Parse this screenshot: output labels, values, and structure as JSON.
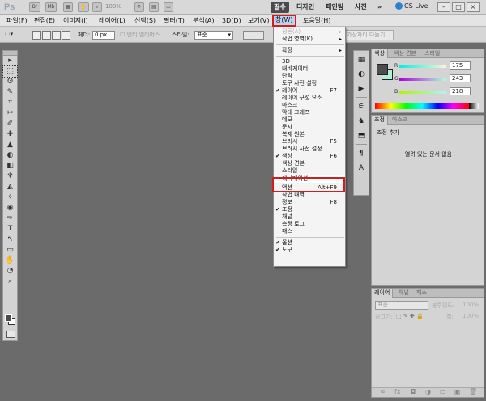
{
  "appbar": {
    "logo": "Ps",
    "icon_br": "Br",
    "icon_mb": "Mb",
    "zoom": "100%",
    "workspaces": [
      "필수",
      "디자인",
      "페인팅",
      "사진"
    ],
    "more": "»",
    "cs_live": "CS Live",
    "win_minimize": "–",
    "win_restore": "□",
    "win_close": "×"
  },
  "menubar": {
    "items": [
      "파일(F)",
      "편집(E)",
      "이미지(I)",
      "레이어(L)",
      "선택(S)",
      "필터(T)",
      "분석(A)",
      "3D(D)",
      "보기(V)",
      "창(W)",
      "도움말(H)"
    ]
  },
  "options": {
    "feather_label": "페더:",
    "feather_value": "0 px",
    "antialias": "앤티 앨리어스",
    "style_label": "스타일:",
    "style_value": "표준",
    "refine_edge": "가장자리 다듬기..."
  },
  "tools": [
    "▸",
    "⬚",
    "ʘ",
    "✎",
    "⌗",
    "✂",
    "✐",
    "✚",
    "▲",
    "◐",
    "◧",
    "♆",
    "◭",
    "✧",
    "◉",
    "✑",
    "T",
    "↖",
    "▭",
    "✋",
    "◔",
    "⌕"
  ],
  "iconstrip": [
    "▦",
    "◐",
    "▶",
    "⚟",
    "♞",
    "⬒",
    "¶",
    "A"
  ],
  "color_panel": {
    "tabs": [
      "색상",
      "색상 견본",
      "스타일"
    ],
    "r_label": "R",
    "g_label": "G",
    "b_label": "B",
    "r_value": "175",
    "g_value": "243",
    "b_value": "218",
    "fg_color": "#4d4d4d",
    "bg_color": "#afefda"
  },
  "adjust_panel": {
    "tabs": [
      "조정",
      "마스크"
    ],
    "title": "조정 추가",
    "empty": "열려 있는 문서 없음"
  },
  "layers_panel": {
    "tabs": [
      "레이어",
      "채널",
      "패스"
    ],
    "blend": "표준",
    "opacity_label": "불투명도:",
    "opacity_value": "100%",
    "lock_label": "잠그기:",
    "fill_label": "칠:",
    "fill_value": "100%",
    "footer_icons": [
      "∞",
      "fx",
      "◘",
      "◑",
      "▭",
      "▣",
      "🗑"
    ]
  },
  "window_menu": {
    "items": [
      {
        "label": "정돈(A)",
        "arrow": "▸"
      },
      {
        "label": "작업 영역(K)",
        "arrow": "▸"
      },
      {
        "label": "확장",
        "arrow": "▸"
      },
      {
        "label": "3D"
      },
      {
        "label": "내비게이터"
      },
      {
        "label": "단락"
      },
      {
        "label": "도구 사전 설정"
      },
      {
        "label": "레이어",
        "shortcut": "F7",
        "checked": true
      },
      {
        "label": "레이어 구성 요소"
      },
      {
        "label": "마스크"
      },
      {
        "label": "막대 그래프"
      },
      {
        "label": "메모"
      },
      {
        "label": "문자"
      },
      {
        "label": "복제 원본"
      },
      {
        "label": "브러시",
        "shortcut": "F5"
      },
      {
        "label": "브러시 사전 설정"
      },
      {
        "label": "색상",
        "shortcut": "F6",
        "checked": true
      },
      {
        "label": "색상 견본"
      },
      {
        "label": "스타일"
      },
      {
        "label": "애니메이션"
      },
      {
        "label": "액션",
        "shortcut": "Alt+F9"
      },
      {
        "label": "작업 내역"
      },
      {
        "label": "정보",
        "shortcut": "F8"
      },
      {
        "label": "조정",
        "checked": true
      },
      {
        "label": "채널"
      },
      {
        "label": "측정 로그"
      },
      {
        "label": "패스"
      },
      {
        "label": "옵션",
        "checked": true
      },
      {
        "label": "도구",
        "checked": true
      }
    ]
  }
}
